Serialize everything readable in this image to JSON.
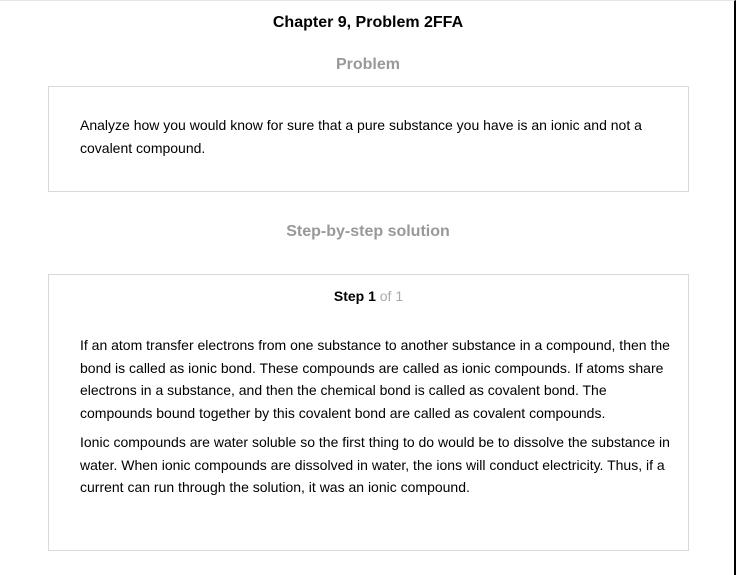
{
  "page_title": "Chapter 9, Problem 2FFA",
  "problem": {
    "heading": "Problem",
    "text": "Analyze how you would know for sure that a pure substance you have is an ionic and not a covalent compound."
  },
  "solution": {
    "heading": "Step-by-step solution",
    "step": {
      "label": "Step 1",
      "of": "of 1",
      "paragraphs": [
        "If an atom transfer electrons from one substance to another substance in a compound, then the bond is called as ionic bond. These compounds are called as ionic compounds. If atoms share electrons in a substance, and then the chemical bond is called as covalent bond. The compounds bound together by this covalent bond are called as covalent compounds.",
        "Ionic compounds are water soluble so the first thing to do would be to dissolve the substance in water. When ionic compounds are dissolved in water, the ions will conduct electricity. Thus, if a current can run through the solution, it was an ionic compound."
      ]
    }
  }
}
